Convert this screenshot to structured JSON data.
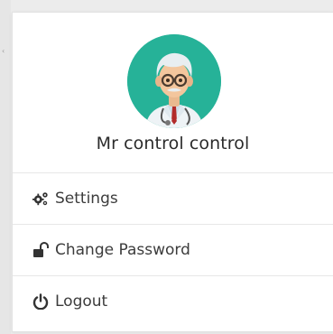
{
  "user": {
    "name": "Mr control control",
    "avatar_icon": "doctor-avatar-icon"
  },
  "menu": [
    {
      "id": "settings",
      "label": "Settings",
      "icon": "gears-icon"
    },
    {
      "id": "change-password",
      "label": "Change Password",
      "icon": "unlock-icon"
    },
    {
      "id": "logout",
      "label": "Logout",
      "icon": "power-icon"
    }
  ],
  "colors": {
    "avatar_bg": "#26b298",
    "text": "#2b2b2b",
    "icon": "#333333"
  }
}
